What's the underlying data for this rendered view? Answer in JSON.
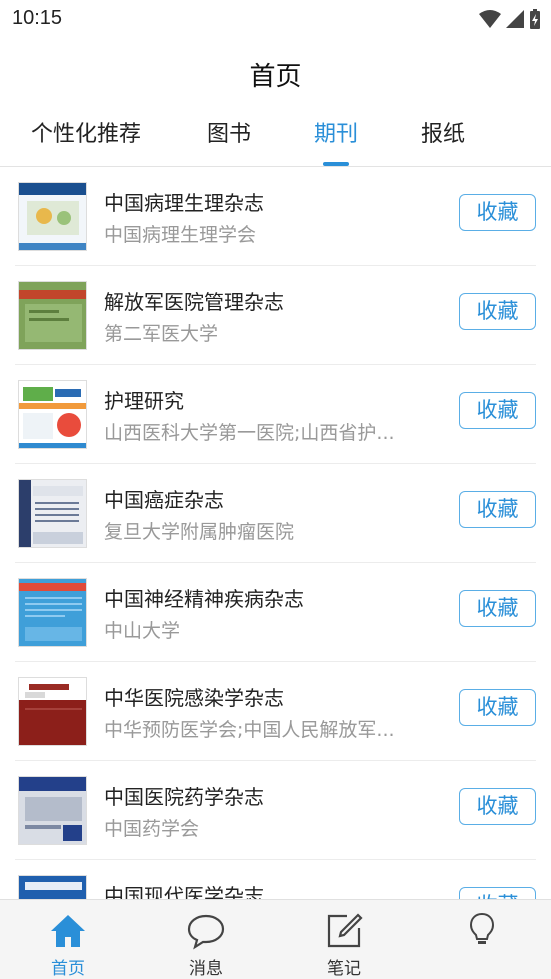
{
  "status_bar": {
    "time": "10:15"
  },
  "header": {
    "title": "首页"
  },
  "tabs": [
    {
      "label": "个性化推荐",
      "active": false
    },
    {
      "label": "图书",
      "active": false
    },
    {
      "label": "期刊",
      "active": true
    },
    {
      "label": "报纸",
      "active": false
    }
  ],
  "journals": [
    {
      "title": "中国病理生理杂志",
      "publisher": "中国病理生理学会",
      "action": "收藏"
    },
    {
      "title": "解放军医院管理杂志",
      "publisher": "第二军医大学",
      "action": "收藏"
    },
    {
      "title": "护理研究",
      "publisher": "山西医科大学第一医院;山西省护...",
      "action": "收藏"
    },
    {
      "title": "中国癌症杂志",
      "publisher": "复旦大学附属肿瘤医院",
      "action": "收藏"
    },
    {
      "title": "中国神经精神疾病杂志",
      "publisher": "中山大学",
      "action": "收藏"
    },
    {
      "title": "中华医院感染学杂志",
      "publisher": "中华预防医学会;中国人民解放军...",
      "action": "收藏"
    },
    {
      "title": "中国医院药学杂志",
      "publisher": "中国药学会",
      "action": "收藏"
    },
    {
      "title": "中国现代医学杂志",
      "publisher": "",
      "action": "收藏"
    }
  ],
  "bottom_nav": [
    {
      "label": "首页",
      "icon": "home-icon",
      "active": true
    },
    {
      "label": "消息",
      "icon": "message-icon",
      "active": false
    },
    {
      "label": "笔记",
      "icon": "note-icon",
      "active": false
    },
    {
      "label": "",
      "icon": "lightbulb-icon",
      "active": false
    }
  ],
  "colors": {
    "accent": "#2a8fd8",
    "divider": "#ececec"
  }
}
